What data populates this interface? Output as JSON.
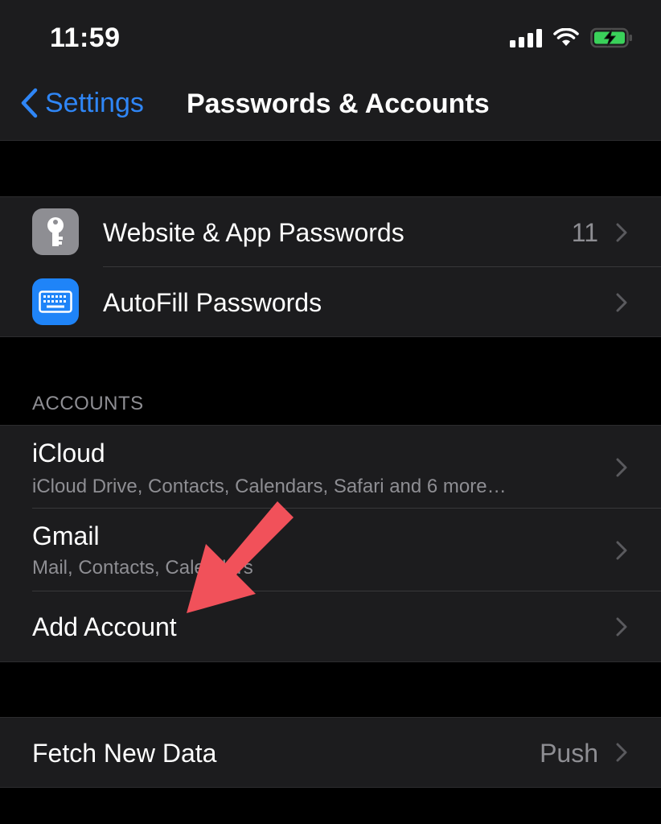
{
  "status_bar": {
    "time": "11:59",
    "icons": [
      "cellular-signal-icon",
      "wifi-icon",
      "battery-charging-icon"
    ]
  },
  "nav": {
    "back_label": "Settings",
    "title": "Passwords & Accounts"
  },
  "passwords_group": [
    {
      "label": "Website & App Passwords",
      "value": "11",
      "icon": "key-icon"
    },
    {
      "label": "AutoFill Passwords",
      "value": "",
      "icon": "keyboard-icon"
    }
  ],
  "accounts_section": {
    "header": "ACCOUNTS",
    "items": [
      {
        "label": "iCloud",
        "detail": "iCloud Drive, Contacts, Calendars, Safari and 6 more…"
      },
      {
        "label": "Gmail",
        "detail": "Mail, Contacts, Calendars"
      },
      {
        "label": "Add Account",
        "detail": ""
      }
    ]
  },
  "fetch_group": {
    "label": "Fetch New Data",
    "value": "Push"
  },
  "colors": {
    "accent": "#2f86f6",
    "annotation_arrow": "#f1515a",
    "cell_background": "#1c1c1e",
    "secondary_text": "#8e8e93"
  }
}
